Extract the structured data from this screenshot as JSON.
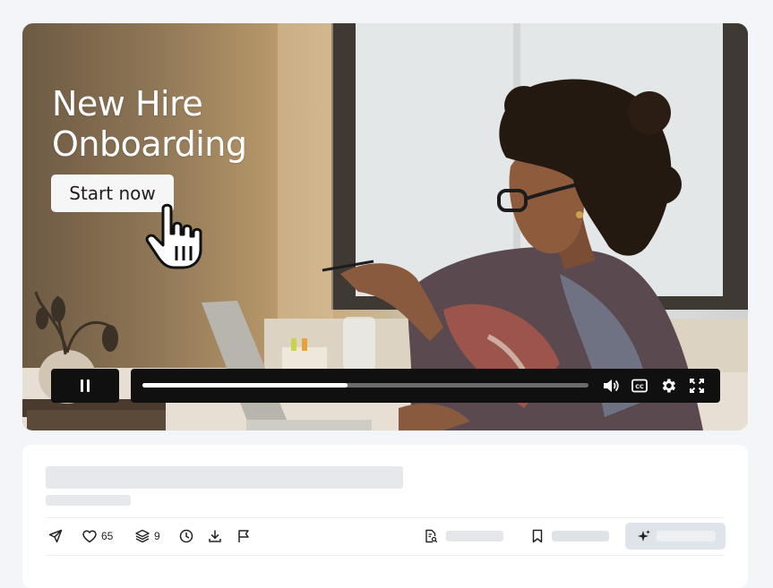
{
  "video": {
    "title": "New Hire\nOnboarding",
    "start_button": "Start now",
    "progress_fraction": 0.46
  },
  "actions": {
    "likes": "65",
    "layers": "9"
  },
  "icons": [
    "pause-icon",
    "volume-icon",
    "cc-icon",
    "settings-icon",
    "fullscreen-icon",
    "send-icon",
    "heart-icon",
    "layers-icon",
    "clock-icon",
    "download-icon",
    "flag-icon",
    "doc-search-icon",
    "bookmark-icon",
    "sparkle-icon",
    "pointer-hand-icon"
  ],
  "colors": {
    "control_bg": "#101010",
    "skeleton": "#e6e8ec",
    "ai_button": "#dfe3ea"
  }
}
